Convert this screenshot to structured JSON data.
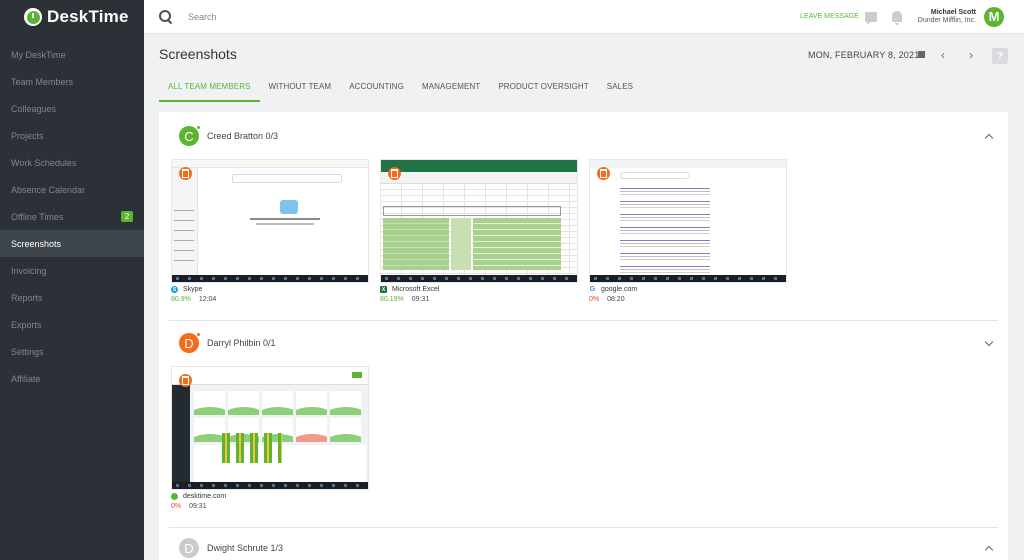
{
  "app": {
    "name": "DeskTime"
  },
  "sidebar": {
    "items": [
      {
        "label": "My DeskTime"
      },
      {
        "label": "Team Members"
      },
      {
        "label": "Colleagues"
      },
      {
        "label": "Projects"
      },
      {
        "label": "Work Schedules"
      },
      {
        "label": "Absence Calendar"
      },
      {
        "label": "Offline Times",
        "badge": "2"
      },
      {
        "label": "Screenshots",
        "active": true
      },
      {
        "label": "Invoicing"
      },
      {
        "label": "Reports"
      },
      {
        "label": "Exports"
      },
      {
        "label": "Settings"
      },
      {
        "label": "Affiliate"
      }
    ]
  },
  "topbar": {
    "search_placeholder": "Search",
    "leave_message": "LEAVE MESSAGE",
    "user_name": "Michael Scott",
    "user_company": "Dunder Mifflin, Inc.",
    "user_initial": "M"
  },
  "page": {
    "title": "Screenshots",
    "date": "MON, FEBRUARY 8, 2021",
    "help": "?"
  },
  "tabs": [
    {
      "label": "ALL TEAM MEMBERS",
      "active": true
    },
    {
      "label": "WITHOUT TEAM"
    },
    {
      "label": "ACCOUNTING"
    },
    {
      "label": "MANAGEMENT"
    },
    {
      "label": "PRODUCT OVERSIGHT"
    },
    {
      "label": "SALES"
    }
  ],
  "members": [
    {
      "initial": "C",
      "name": "Creed Bratton",
      "count": "0/3",
      "avatar_color": "#5cb531",
      "status_color": "#5cb531",
      "screenshots": [
        {
          "app": "Skype",
          "icon": "skype-icon",
          "percent": "80.9%",
          "percent_color": "#5cb531",
          "time": "12:04"
        },
        {
          "app": "Microsoft Excel",
          "icon": "excel-icon",
          "percent": "80.19%",
          "percent_color": "#5cb531",
          "time": "09:31"
        },
        {
          "app": "google.com",
          "icon": "google-icon",
          "percent": "0%",
          "percent_color": "#e8452c",
          "time": "08:20"
        }
      ]
    },
    {
      "initial": "D",
      "name": "Darryl Philbin",
      "count": "0/1",
      "avatar_color": "#f26c1b",
      "status_color": "#f26c1b",
      "screenshots": [
        {
          "app": "desktime.com",
          "icon": "desktime-icon",
          "percent": "0%",
          "percent_color": "#e8452c",
          "time": "09:31"
        }
      ]
    },
    {
      "initial": "D",
      "name": "Dwight Schrute",
      "count": "1/3",
      "avatar_color": "#c9cbce",
      "status_color": "#c9cbce",
      "screenshots": []
    }
  ]
}
